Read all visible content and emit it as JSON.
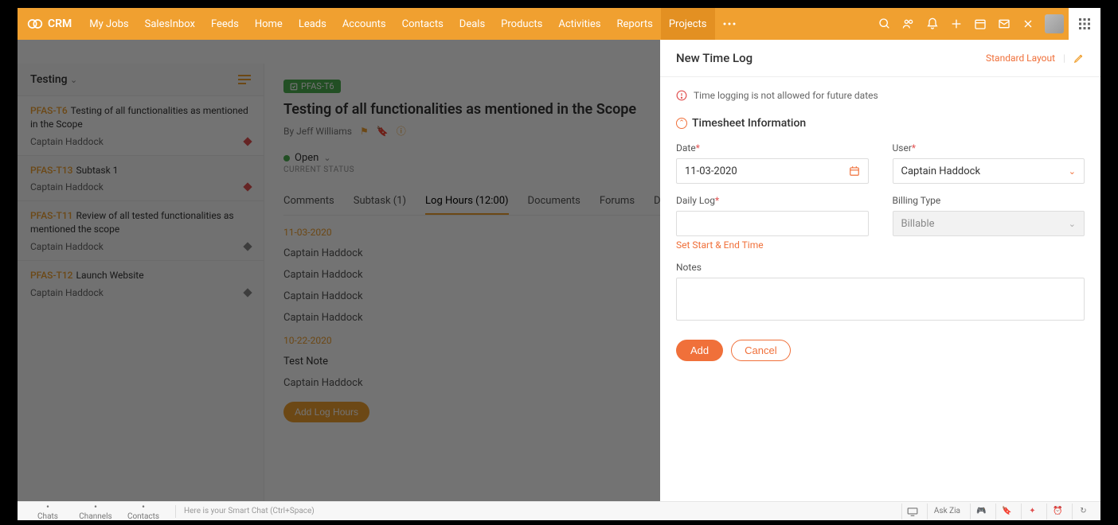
{
  "brand": "CRM",
  "nav": [
    "My Jobs",
    "SalesInbox",
    "Feeds",
    "Home",
    "Leads",
    "Accounts",
    "Contacts",
    "Deals",
    "Products",
    "Activities",
    "Reports",
    "Projects"
  ],
  "nav_active": 11,
  "sidebar": {
    "title": "Testing",
    "tasks": [
      {
        "code": "PFAS-T6",
        "title": "Testing of all functionalities as mentioned in the Scope",
        "owner": "Captain Haddock",
        "diamond": "red",
        "selected": true
      },
      {
        "code": "PFAS-T13",
        "title": "Subtask 1",
        "owner": "Captain Haddock",
        "diamond": "red",
        "selected": false
      },
      {
        "code": "PFAS-T11",
        "title": "Review of all tested functionalities as mentioned the scope",
        "owner": "Captain Haddock",
        "diamond": "gray",
        "selected": false
      },
      {
        "code": "PFAS-T12",
        "title": "Launch Website",
        "owner": "Captain Haddock",
        "diamond": "gray",
        "selected": false
      }
    ]
  },
  "main": {
    "chip": "PFAS-T6",
    "title": "Testing of all functionalities as mentioned in the Scope",
    "byline": "By Jeff Williams",
    "status": "Open",
    "status_label": "CURRENT STATUS",
    "tabs": [
      {
        "label": "Comments"
      },
      {
        "label": "Subtask (1)"
      },
      {
        "label": "Log Hours (12:00)",
        "active": true
      },
      {
        "label": "Documents"
      },
      {
        "label": "Forums"
      },
      {
        "label": "Depender"
      }
    ],
    "log_groups": [
      {
        "date": "11-03-2020",
        "entries": [
          "Captain Haddock",
          "Captain Haddock",
          "Captain Haddock",
          "Captain Haddock"
        ]
      },
      {
        "date": "10-22-2020",
        "note": "Test Note",
        "entries": [
          "Captain Haddock"
        ]
      }
    ],
    "add_log": "Add Log Hours"
  },
  "panel": {
    "title": "New Time Log",
    "layout_label": "Standard Layout",
    "alert": "Time logging is not allowed for future dates",
    "section": "Timesheet Information",
    "fields": {
      "date": {
        "label": "Date",
        "value": "11-03-2020"
      },
      "user": {
        "label": "User",
        "value": "Captain Haddock"
      },
      "daily": {
        "label": "Daily Log"
      },
      "billing": {
        "label": "Billing Type",
        "value": "Billable"
      },
      "notes": {
        "label": "Notes"
      }
    },
    "set_time": "Set Start & End Time",
    "add": "Add",
    "cancel": "Cancel"
  },
  "footer": {
    "items": [
      "Chats",
      "Channels",
      "Contacts"
    ],
    "hint": "Here is your Smart Chat (Ctrl+Space)",
    "ask": "Ask Zia"
  }
}
